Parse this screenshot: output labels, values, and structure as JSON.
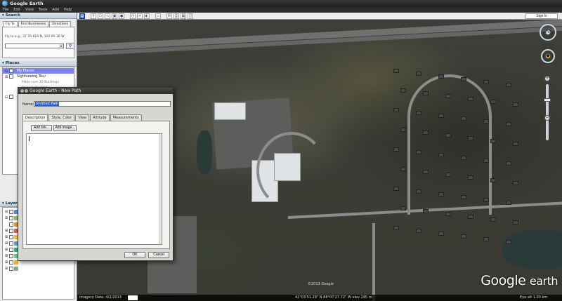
{
  "app": {
    "title": "Google Earth"
  },
  "menu": [
    "File",
    "Edit",
    "View",
    "Tools",
    "Add",
    "Help"
  ],
  "toolbar": {
    "signin": "Sign In"
  },
  "search": {
    "title": "Search",
    "tabs": [
      "Fly To",
      "Find Businesses",
      "Directions"
    ],
    "flyto_hint": "Fly to e.g., 37 25.818 N, 122 05.36 W",
    "input_value": ""
  },
  "places": {
    "title": "Places",
    "items": [
      {
        "label": "My Places",
        "selected": true
      },
      {
        "label": "Sightseeing Tour",
        "selected": false
      }
    ],
    "sublabel_1": "Make sure 3D Buildings",
    "sublabel_2": "layer is checked"
  },
  "layers": {
    "title": "Layers"
  },
  "dialog": {
    "title": "Google Earth - New Path",
    "name_label": "Name:",
    "name_value": "Untitled Path",
    "tabs": [
      "Description",
      "Style, Color",
      "View",
      "Altitude",
      "Measurements"
    ],
    "add_link": "Add link...",
    "add_image": "Add image...",
    "ok": "OK",
    "cancel": "Cancel"
  },
  "map": {
    "copyright": "©2013 Google",
    "logo_google": "Google",
    "logo_earth": "earth",
    "imagery_date": "Imagery Date: 4/2/2013",
    "coords": "42°03'51.28\" N  88°07'27.72\" W  elev  245 m",
    "eye_alt": "Eye alt   1.03 km"
  },
  "colors": {
    "selection": "#7b84e8",
    "name_highlight": "#2c5ad3"
  }
}
